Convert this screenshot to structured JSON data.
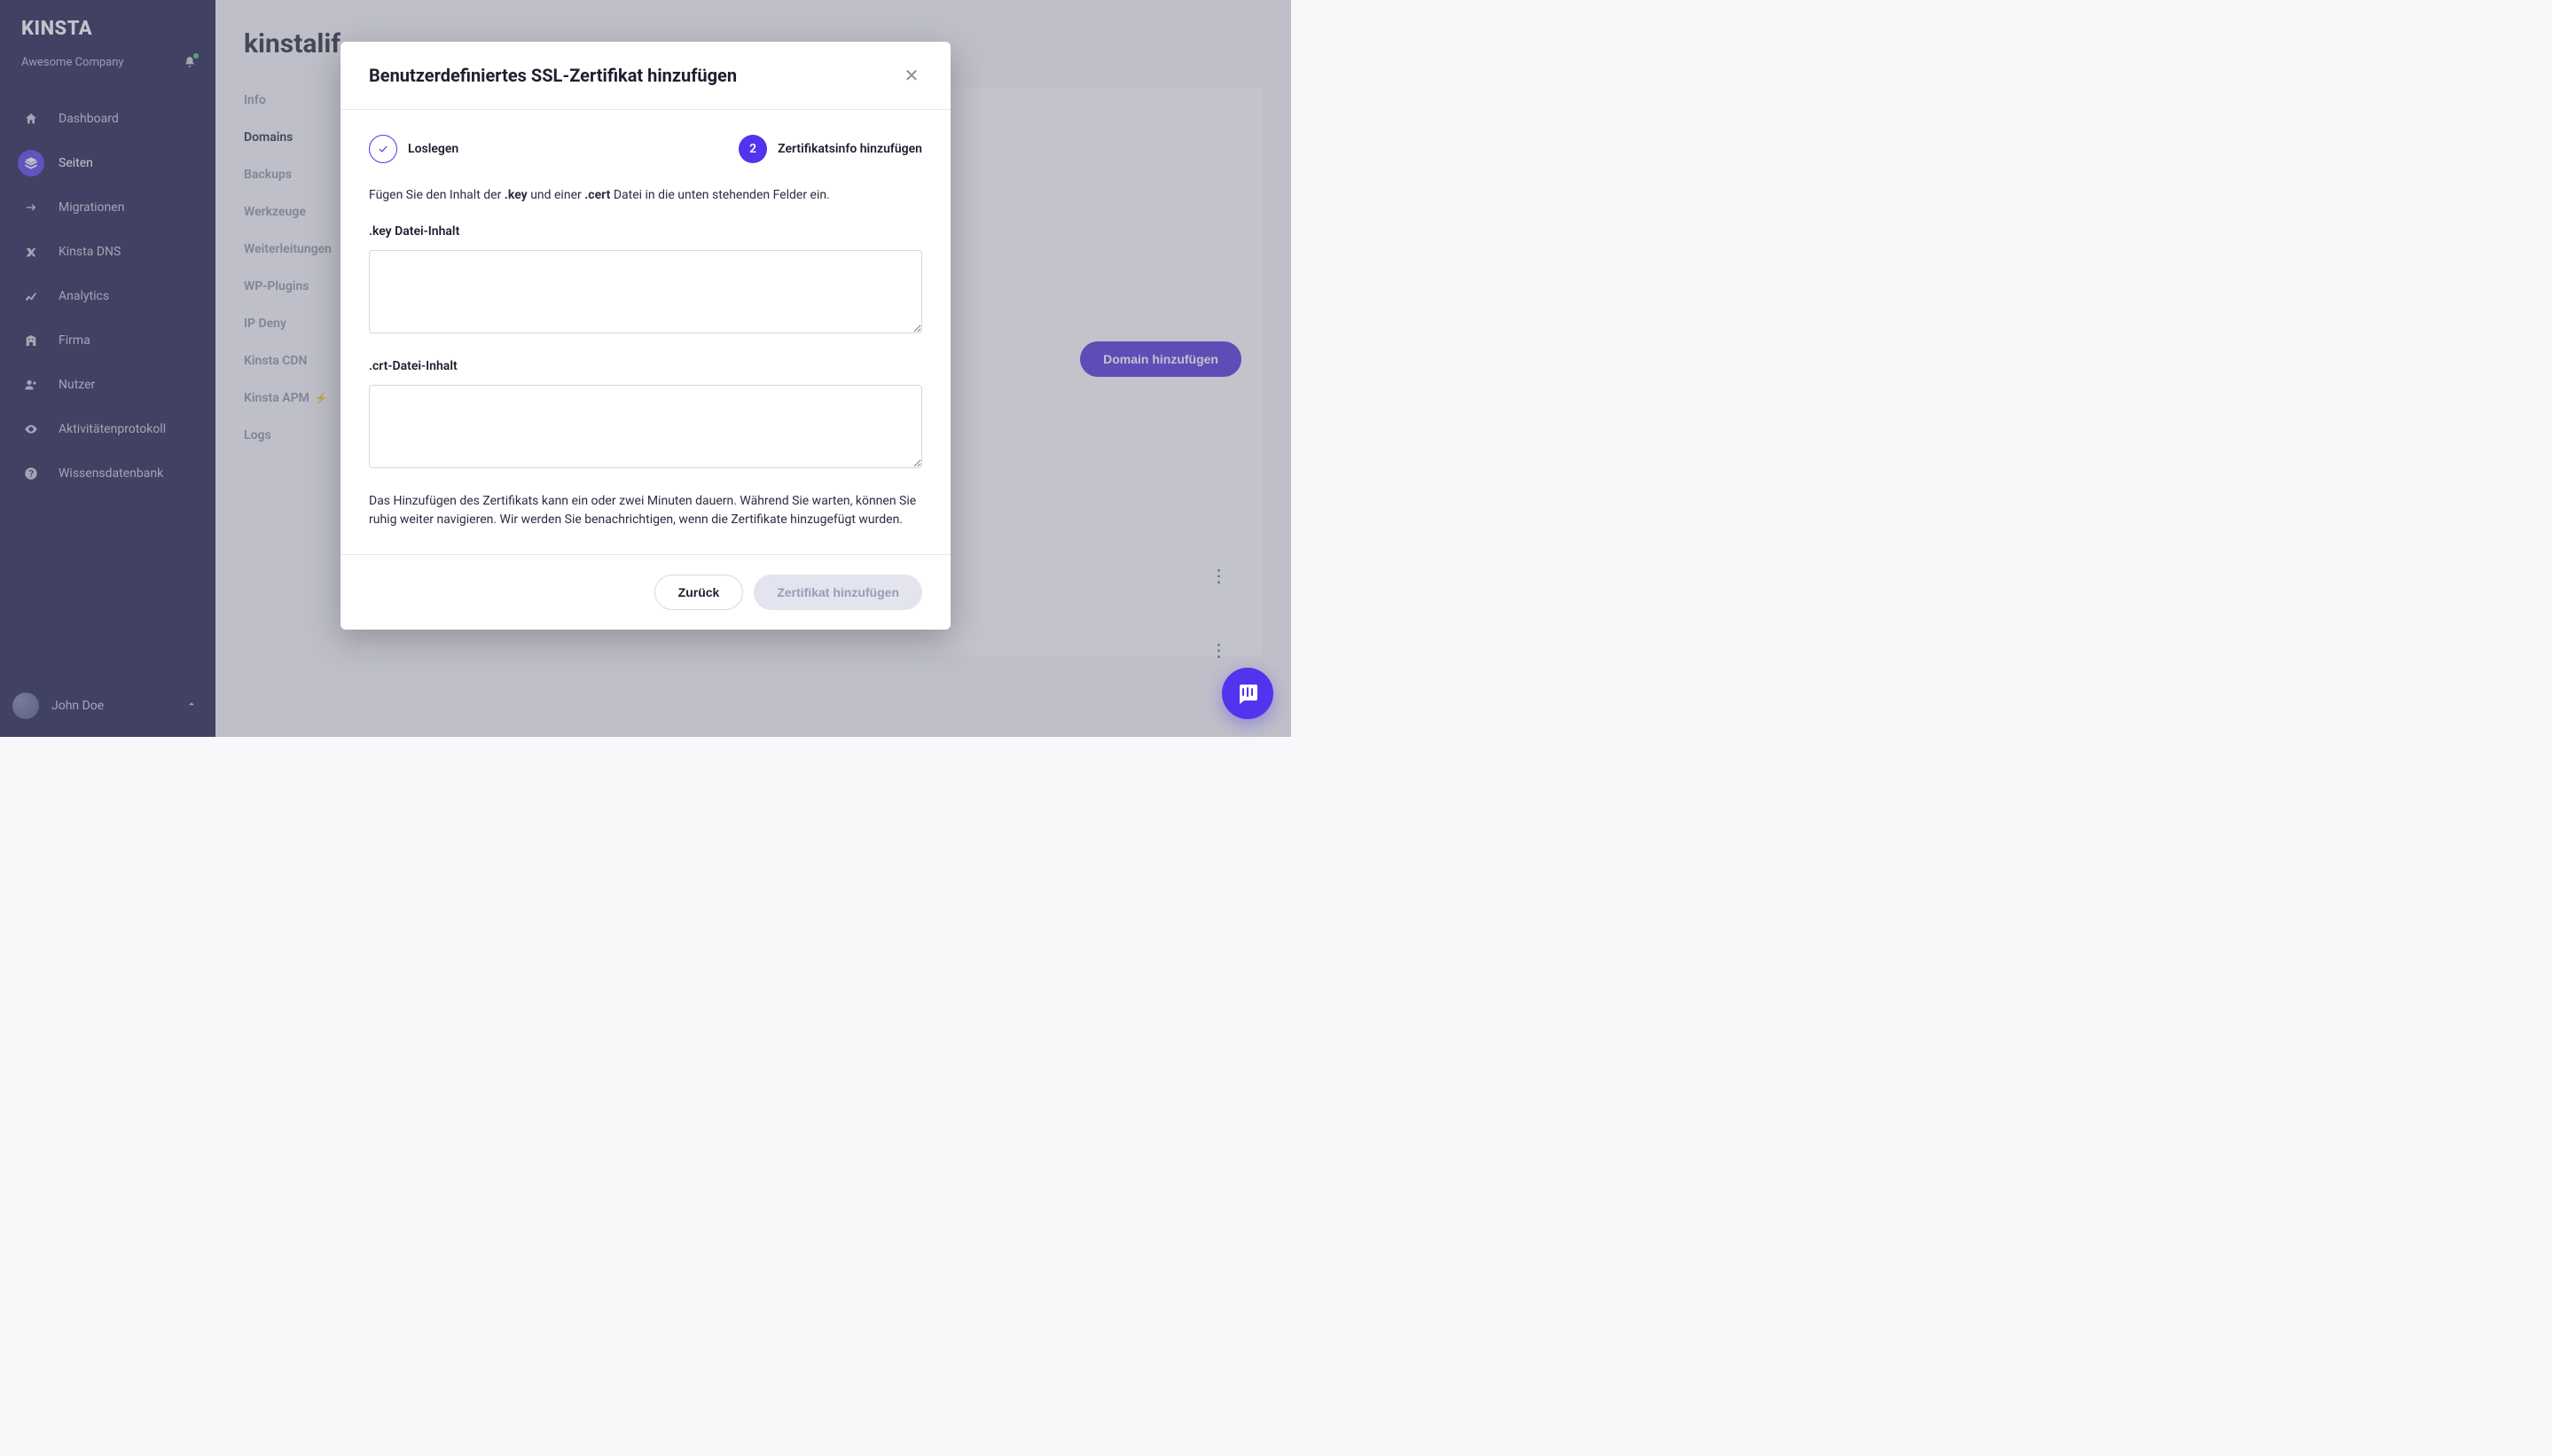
{
  "brand": "KINSTA",
  "company_name": "Awesome Company",
  "nav": {
    "dashboard": "Dashboard",
    "sites": "Seiten",
    "migrations": "Migrationen",
    "dns": "Kinsta DNS",
    "analytics": "Analytics",
    "company": "Firma",
    "users": "Nutzer",
    "activity": "Aktivitätenprotokoll",
    "kb": "Wissensdatenbank"
  },
  "user": {
    "name": "John Doe"
  },
  "page": {
    "title_partial": "kinstalif",
    "add_domain_btn": "Domain hinzufügen"
  },
  "subnav": {
    "info": "Info",
    "domains": "Domains",
    "backups": "Backups",
    "tools": "Werkzeuge",
    "redirects": "Weiterleitungen",
    "wp_plugins": "WP-Plugins",
    "ip_deny": "IP Deny",
    "cdn": "Kinsta CDN",
    "apm": "Kinsta APM",
    "logs": "Logs"
  },
  "modal": {
    "title": "Benutzerdefiniertes SSL-Zertifikat hinzufügen",
    "step1_label": "Loslegen",
    "step2_num": "2",
    "step2_label": "Zertifikatsinfo hinzufügen",
    "intro_pre": "Fügen Sie den Inhalt der ",
    "intro_key": ".key",
    "intro_mid": " und einer ",
    "intro_cert": ".cert",
    "intro_post": " Datei in die unten stehenden Felder ein.",
    "key_label": ".key Datei-Inhalt",
    "crt_label": ".crt-Datei-Inhalt",
    "note": "Das Hinzufügen des Zertifikats kann ein oder zwei Minuten dauern. Während Sie warten, können Sie ruhig weiter navigieren. Wir werden Sie benachrichtigen, wenn die Zertifikate hinzugefügt wurden.",
    "back_btn": "Zurück",
    "submit_btn": "Zertifikat hinzufügen"
  }
}
